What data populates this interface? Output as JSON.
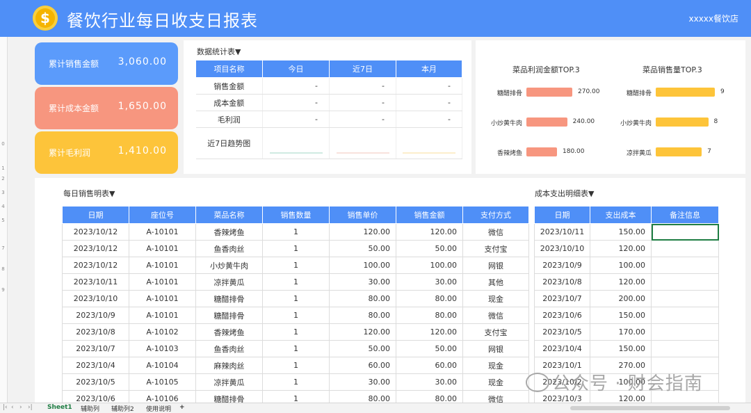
{
  "header": {
    "title": "餐饮行业每日收支日报表",
    "coin_symbol": "$",
    "shop": "xxxxx餐饮店"
  },
  "kpis": [
    {
      "label": "累计销售金额",
      "value": "3,060.00",
      "color": "#5b9bfb"
    },
    {
      "label": "累计成本金额",
      "value": "1,650.00",
      "color": "#f7967f"
    },
    {
      "label": "累计毛利润",
      "value": "1,410.00",
      "color": "#fdc43a"
    }
  ],
  "stats": {
    "label": "数据统计表▼",
    "headers": [
      "项目名称",
      "今日",
      "近7日",
      "本月"
    ],
    "rows": [
      [
        "销售金额",
        "-",
        "-",
        "-"
      ],
      [
        "成本金额",
        "-",
        "-",
        "-"
      ],
      [
        "毛利润",
        "-",
        "-",
        "-"
      ]
    ],
    "trend_label": "近7日趋势图"
  },
  "top3_profit": {
    "title": "菜品利润金额TOP.3",
    "items": [
      {
        "name": "糖醋排骨",
        "value": "270.00",
        "amount": 270
      },
      {
        "name": "小炒黄牛肉",
        "value": "240.00",
        "amount": 240
      },
      {
        "name": "香辣烤鱼",
        "value": "180.00",
        "amount": 180
      }
    ]
  },
  "top3_sales": {
    "title": "菜品销售量TOP.3",
    "items": [
      {
        "name": "糖醋排骨",
        "value": "9",
        "amount": 9
      },
      {
        "name": "小炒黄牛肉",
        "value": "8",
        "amount": 8
      },
      {
        "name": "凉拌黄瓜",
        "value": "7",
        "amount": 7
      }
    ]
  },
  "daily_sales": {
    "label": "每日销售明表▼",
    "headers": [
      "日期",
      "座位号",
      "菜品名称",
      "销售数量",
      "销售单价",
      "销售金额",
      "支付方式"
    ],
    "rows": [
      [
        "2023/10/12",
        "A-10101",
        "香辣烤鱼",
        "1",
        "120.00",
        "120.00",
        "微信"
      ],
      [
        "2023/10/12",
        "A-10101",
        "鱼香肉丝",
        "1",
        "50.00",
        "50.00",
        "支付宝"
      ],
      [
        "2023/10/12",
        "A-10101",
        "小炒黄牛肉",
        "1",
        "100.00",
        "100.00",
        "网银"
      ],
      [
        "2023/10/11",
        "A-10101",
        "凉拌黄瓜",
        "1",
        "30.00",
        "30.00",
        "其他"
      ],
      [
        "2023/10/10",
        "A-10101",
        "糖醋排骨",
        "1",
        "80.00",
        "80.00",
        "现金"
      ],
      [
        "2023/10/9",
        "A-10101",
        "糖醋排骨",
        "1",
        "80.00",
        "80.00",
        "微信"
      ],
      [
        "2023/10/8",
        "A-10102",
        "香辣烤鱼",
        "1",
        "120.00",
        "120.00",
        "支付宝"
      ],
      [
        "2023/10/7",
        "A-10103",
        "鱼香肉丝",
        "1",
        "50.00",
        "50.00",
        "网银"
      ],
      [
        "2023/10/4",
        "A-10104",
        "麻辣肉丝",
        "1",
        "60.00",
        "60.00",
        "现金"
      ],
      [
        "2023/10/5",
        "A-10105",
        "凉拌黄瓜",
        "1",
        "30.00",
        "30.00",
        "现金"
      ],
      [
        "2023/10/6",
        "A-10106",
        "糖醋排骨",
        "1",
        "80.00",
        "80.00",
        "微信"
      ]
    ]
  },
  "cost_detail": {
    "label": "成本支出明细表▼",
    "headers": [
      "日期",
      "支出成本",
      "备注信息"
    ],
    "rows": [
      [
        "2023/10/11",
        "150.00",
        ""
      ],
      [
        "2023/10/10",
        "120.00",
        ""
      ],
      [
        "2023/10/9",
        "100.00",
        ""
      ],
      [
        "2023/10/8",
        "120.00",
        ""
      ],
      [
        "2023/10/7",
        "200.00",
        ""
      ],
      [
        "2023/10/6",
        "150.00",
        ""
      ],
      [
        "2023/10/5",
        "170.00",
        ""
      ],
      [
        "2023/10/4",
        "150.00",
        ""
      ],
      [
        "2023/10/1",
        "270.00",
        ""
      ],
      [
        "2023/10/2",
        "100.00",
        ""
      ],
      [
        "2023/10/3",
        "120.00",
        ""
      ]
    ]
  },
  "sheet_tabs": [
    "Sheet1",
    "辅助列",
    "辅助列2",
    "使用说明",
    "+"
  ],
  "watermark": "公众号 · 财会指南",
  "colors": {
    "header": "#4f8ff7",
    "profit_bar": "#f7967f",
    "sales_bar": "#fdc43a",
    "selected_border": "#1e7d43"
  }
}
